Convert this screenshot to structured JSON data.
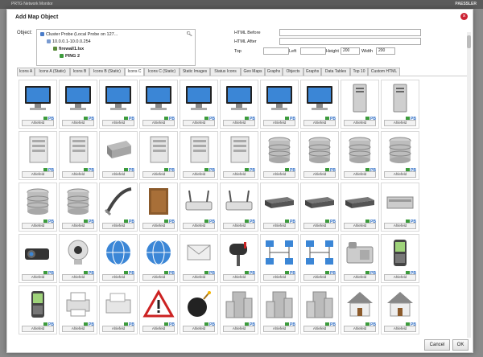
{
  "background": {
    "app_title": "PRTG Network Monitor",
    "logo": "PAESSLER"
  },
  "dialog": {
    "title": "Add Map Object",
    "close_label": "×",
    "object_label": "Object:",
    "tree": [
      "Cluster Probe (Local Probe on 127...",
      "10.0.0.1-10.0.0.254",
      "firewall1.lsx",
      "PING 2"
    ],
    "fields": {
      "html_before": "HTML Before",
      "html_after": "HTML After",
      "top": "Top",
      "left": "Left",
      "height": "Height",
      "height_value": "200",
      "width": "Width",
      "width_value": "200"
    },
    "tabs": [
      "Icons A",
      "Icons A (Static)",
      "Icons B",
      "Icons B (Static)",
      "Icons C",
      "Icons C (Static)",
      "Static Images",
      "Status Icons",
      "Geo Maps",
      "Graphs",
      "Objects",
      "Graphs",
      "Data Tables",
      "Top 10",
      "Custom HTML"
    ],
    "active_tab": 4,
    "cell_select": "Ahlefeld",
    "cell_badge": "PB",
    "icons": [
      "monitor-icon",
      "monitor-icon",
      "monitor-icon",
      "monitor-icon",
      "monitor-icon",
      "monitor-icon",
      "monitor-icon",
      "monitor-icon",
      "server-tower-icon",
      "server-tower-icon",
      "server-icon",
      "server-icon",
      "hard-drive-icon",
      "server-icon",
      "server-icon",
      "server-icon",
      "database-icon",
      "database-icon",
      "database-icon",
      "database-icon",
      "database-icon",
      "database-icon",
      "cable-icon",
      "cabinet-icon",
      "router-icon",
      "router-icon",
      "switch-icon",
      "switch-icon",
      "switch-icon",
      "appliance-icon",
      "projector-icon",
      "webcam-icon",
      "globe-icon",
      "globe-icon",
      "mail-icon",
      "mailbox-icon",
      "network-icon",
      "network-icon",
      "phone-icon",
      "mobile-phone-icon",
      "mobile-phone-icon",
      "printer-icon",
      "fax-icon",
      "warning-icon",
      "bomb-icon",
      "building-icon",
      "building-icon",
      "building-icon",
      "house-icon",
      "house-icon"
    ],
    "buttons": {
      "cancel": "Cancel",
      "ok": "OK"
    }
  }
}
